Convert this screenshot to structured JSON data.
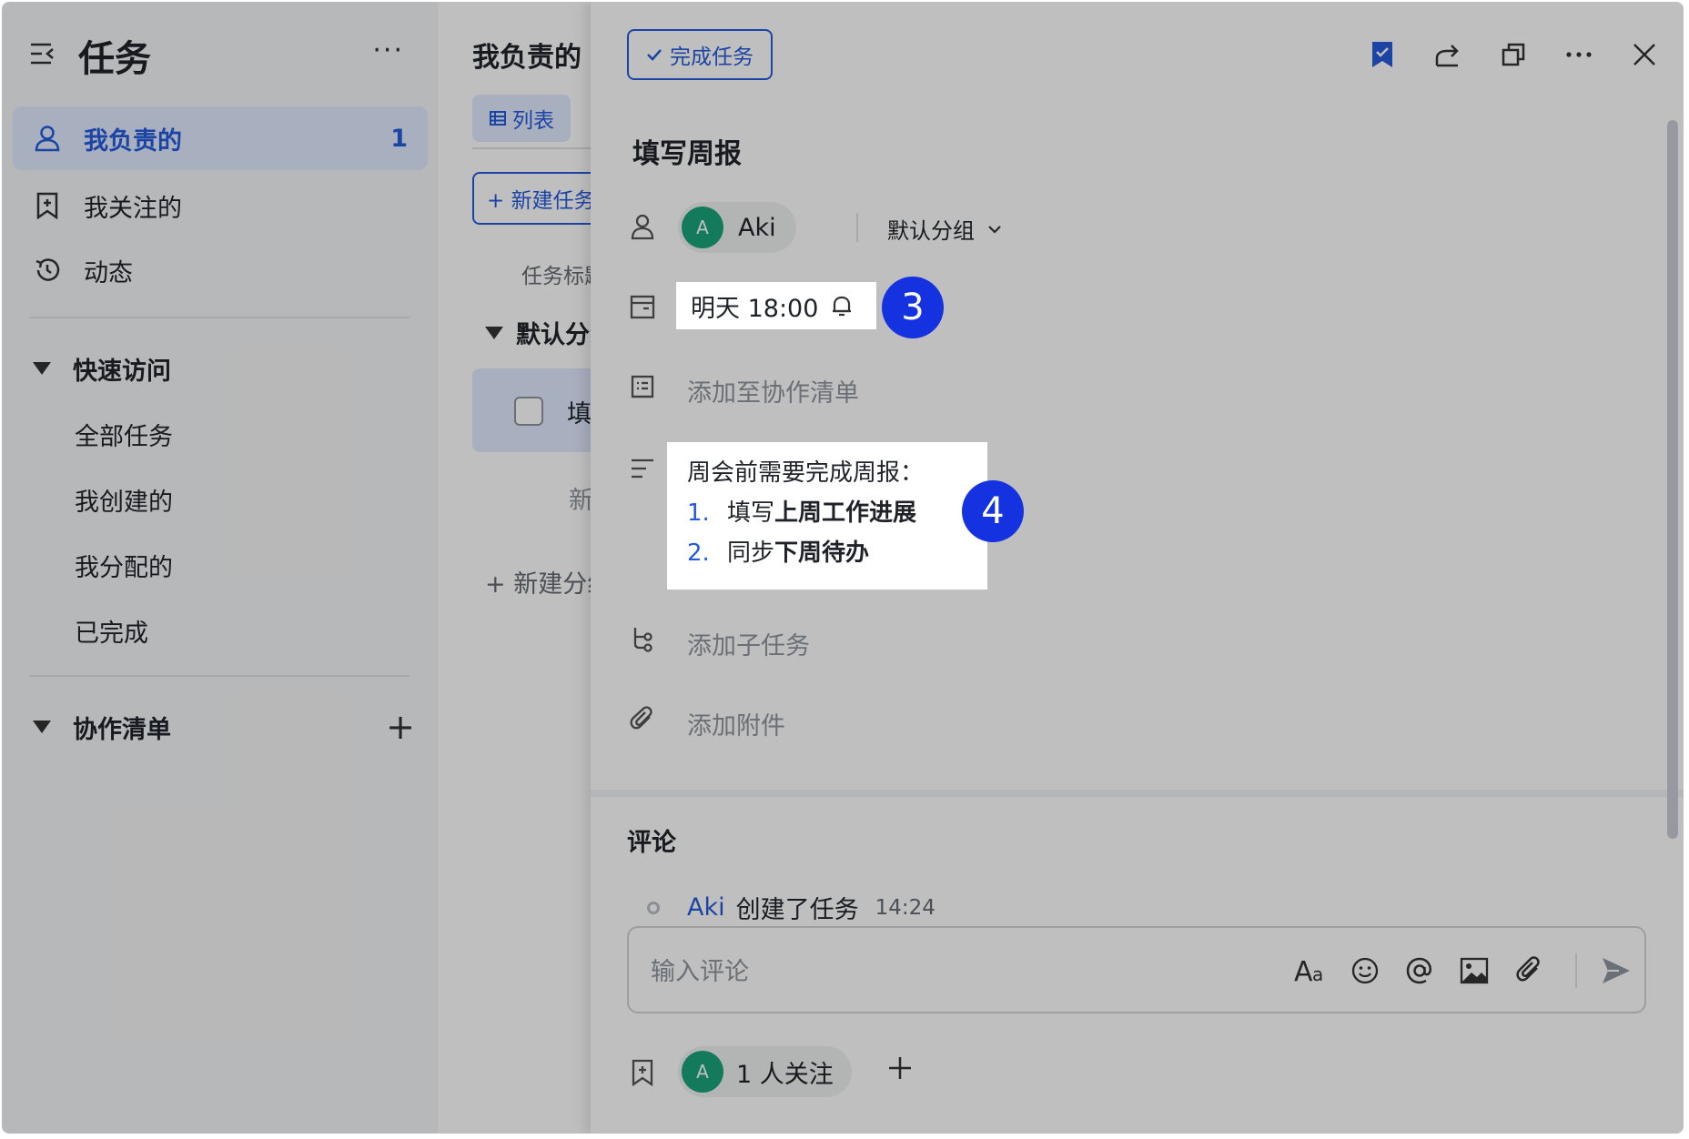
{
  "sidebar": {
    "title": "任务",
    "more": "···",
    "items": [
      {
        "label": "我负责的",
        "count": "1",
        "icon": "person-icon"
      },
      {
        "label": "我关注的",
        "count": "",
        "icon": "bookmark-icon"
      },
      {
        "label": "动态",
        "count": "",
        "icon": "history-icon"
      }
    ],
    "quick_access": {
      "label": "快速访问",
      "items": [
        "全部任务",
        "我创建的",
        "我分配的",
        "已完成"
      ]
    },
    "collab": {
      "label": "协作清单",
      "add": "+"
    }
  },
  "list": {
    "title": "我负责的",
    "view_tab": "列表",
    "new_task": "+ 新建任务",
    "column_header": "任务标题",
    "group": "默认分组",
    "task_title": "填写周报",
    "new_task_inline": "新建任务",
    "new_group": "+ 新建分组"
  },
  "detail": {
    "complete_button": "完成任务",
    "title": "填写周报",
    "assignee": {
      "initial": "A",
      "name": "Aki"
    },
    "group_select": "默认分组",
    "due": "明天 18:00",
    "add_to_list": "添加至协作清单",
    "description": {
      "intro": "周会前需要完成周报：",
      "items": [
        {
          "num": "1.",
          "prefix": "填写",
          "bold": "上周工作进展"
        },
        {
          "num": "2.",
          "prefix": "同步",
          "bold": "下周待办"
        }
      ]
    },
    "add_subtask": "添加子任务",
    "add_attachment": "添加附件",
    "comments": {
      "heading": "评论",
      "activity": {
        "user": "Aki",
        "action": "创建了任务",
        "time": "14:24"
      },
      "placeholder": "输入评论"
    },
    "followers": {
      "initial": "A",
      "label": "1 人关注"
    }
  },
  "annotations": [
    "3",
    "4"
  ],
  "colors": {
    "accent": "#245bdb",
    "badge": "#1432e0",
    "avatar": "#1aa37a"
  }
}
